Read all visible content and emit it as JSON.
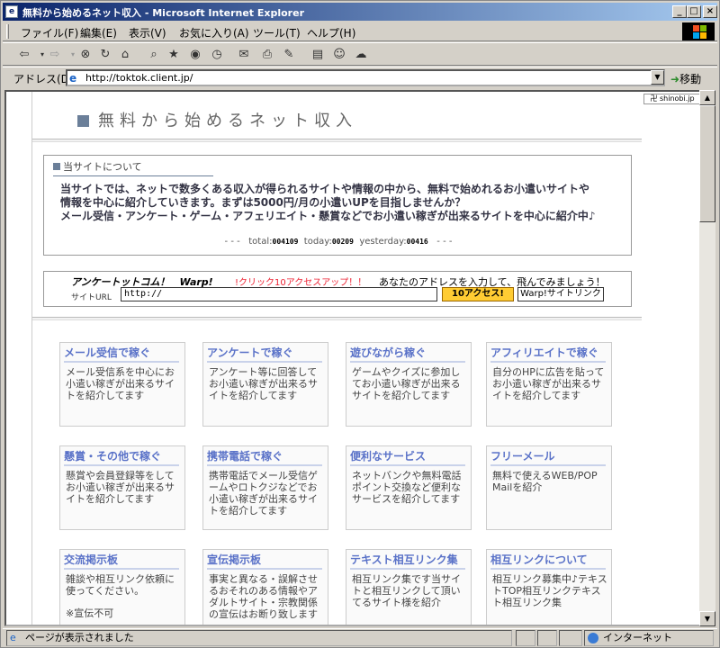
{
  "window": {
    "title": "無料から始めるネット収入 - Microsoft Internet Explorer"
  },
  "menu": {
    "items": [
      "ファイル(F)",
      "編集(E)",
      "表示(V)",
      "お気に入り(A)",
      "ツール(T)",
      "ヘルプ(H)"
    ]
  },
  "address": {
    "label": "アドレス(D)",
    "url": "http://toktok.client.jp/",
    "go": "移動"
  },
  "site": {
    "title": "無料から始めるネット収入"
  },
  "about": {
    "heading": "当サイトについて",
    "line1": "当サイトでは、ネットで数多くある収入が得られるサイトや情報の中から、無料で始めれるお小遣いサイトや",
    "line2": "情報を中心に紹介していきます。まずは5000円/月の小遣いUPを目指しませんか？",
    "line3": "メール受信・アンケート・ゲーム・アフェリエイト・懸賞などでお小遣い稼ぎが出来るサイトを中心に紹介中♪",
    "counter_prefix": "- - -",
    "total_label": "total:",
    "total": "004109",
    "today_label": "today:",
    "today": "00209",
    "yesterday_label": "yesterday:",
    "yesterday": "00416",
    "counter_suffix": "- - -"
  },
  "warp": {
    "title": "アンケートットコム！　Warp!",
    "promo": "!クリック10アクセスアップ！！",
    "info": "あなたのアドレスを入力して、飛んでみましょう！",
    "url_label": "サイトURL",
    "url_value": "http://",
    "access_button": "10アクセス!",
    "link_button": "Warp!サイトリンク"
  },
  "categories": [
    {
      "title": "メール受信で稼ぐ",
      "desc": "メール受信系を中心にお小遣い稼ぎが出来るサイトを紹介してます"
    },
    {
      "title": "アンケートで稼ぐ",
      "desc": "アンケート等に回答してお小遣い稼ぎが出来るサイトを紹介してます"
    },
    {
      "title": "遊びながら稼ぐ",
      "desc": "ゲームやクイズに参加してお小遣い稼ぎが出来るサイトを紹介してます"
    },
    {
      "title": "アフィリエイトで稼ぐ",
      "desc": "自分のHPに広告を貼ってお小遣い稼ぎが出来るサイトを紹介してます"
    },
    {
      "title": "懸賞・その他で稼ぐ",
      "desc": "懸賞や会員登録等をしてお小遣い稼ぎが出来るサイトを紹介してます"
    },
    {
      "title": "携帯電話で稼ぐ",
      "desc": "携帯電話でメール受信ゲームやロトクジなどでお小遣い稼ぎが出来るサイトを紹介してます"
    },
    {
      "title": "便利なサービス",
      "desc": "ネットバンクや無料電話ポイント交換など便利なサービスを紹介してます"
    },
    {
      "title": "フリーメール",
      "desc": "無料で使えるWEB/POP Mailを紹介"
    },
    {
      "title": "交流掲示板",
      "desc": "雑談や相互リンク依頼に使ってください。",
      "note": "※宣伝不可"
    },
    {
      "title": "宣伝掲示板",
      "desc": "事実と異なる・誤解させるおそれのある情報やアダルトサイト・宗教関係の宣伝はお断り致します"
    },
    {
      "title": "テキスト相互リンク集",
      "desc": "相互リンク集です当サイトと相互リンクして頂いてるサイト様を紹介"
    },
    {
      "title": "相互リンクについて",
      "desc": "相互リンク募集中♪テキストTOP相互リンクテキスト相互リンク集"
    }
  ],
  "side": {
    "badge": "shinobi.jp"
  },
  "status": {
    "text": "ページが表示されました",
    "zone": "インターネット"
  },
  "colors": {
    "titlebar": "#0a246a",
    "category_title": "#5a72c8",
    "promo": "#e23333",
    "access_button": "#ffcc33"
  }
}
